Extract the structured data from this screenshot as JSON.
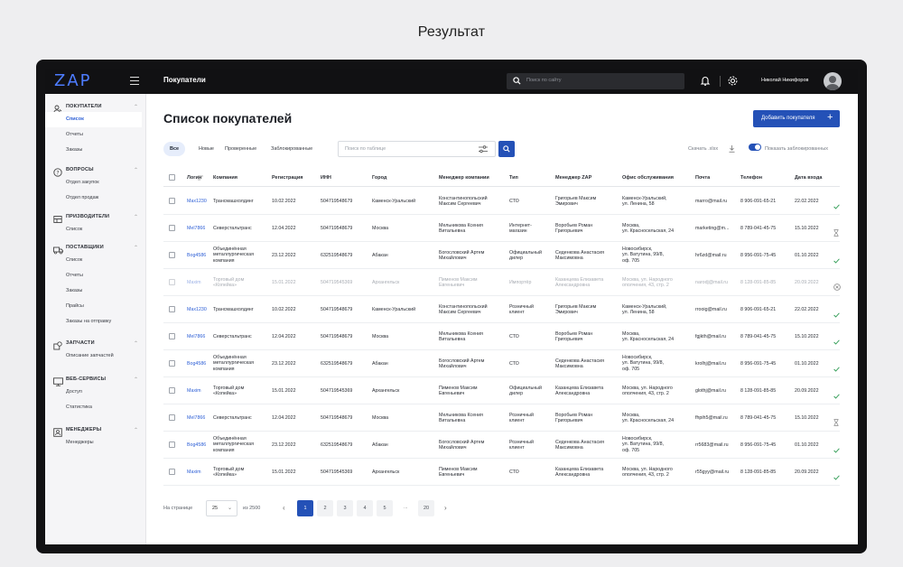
{
  "page_heading": "Результат",
  "topbar": {
    "logo": "ZAP",
    "title": "Покупатели",
    "search_placeholder": "Поиск по сайту",
    "user_name": "Николай Никифоров"
  },
  "sidebar": {
    "sections": [
      {
        "title": "ПОКУПАТЕЛИ",
        "icon": "users-icon",
        "items": [
          "Список",
          "Отчеты",
          "Заказы"
        ]
      },
      {
        "title": "ВОПРОСЫ",
        "icon": "question-icon",
        "items": [
          "Отдел закупок",
          "Отдел продаж"
        ]
      },
      {
        "title": "ПРИЗВОДИТЕЛИ",
        "icon": "factory-icon",
        "items": [
          "Список"
        ]
      },
      {
        "title": "ПОСТАВЩИКИ",
        "icon": "truck-icon",
        "items": [
          "Список",
          "Отчеты",
          "Заказы",
          "Прайсы",
          "Заказы на отправку"
        ]
      },
      {
        "title": "ЗАПЧАСТИ",
        "icon": "parts-icon",
        "items": [
          "Описание запчастей"
        ]
      },
      {
        "title": "ВЕБ-СЕРВИСЫ",
        "icon": "monitor-icon",
        "items": [
          "Доступ",
          "Статистика"
        ]
      },
      {
        "title": "МЕНЕДЖЕРЫ",
        "icon": "id-card-icon",
        "items": [
          "Менеджеры"
        ]
      }
    ]
  },
  "main": {
    "title": "Список покупателей",
    "add_button": "Добавить покупателя",
    "filters": [
      "Все",
      "Новые",
      "Проверенные",
      "Заблокированные"
    ],
    "table_search_placeholder": "Поиск по таблице",
    "download": "Скачать .xlsx",
    "toggle_label": "Показать заблокированных"
  },
  "table": {
    "columns": [
      "Логин",
      "Компания",
      "Регистрация",
      "ИНН",
      "Город",
      "Менеджер компании",
      "Тип",
      "Менеджер ZAP",
      "Офис обслуживания",
      "Почта",
      "Телефон",
      "Дата входа"
    ],
    "rows": [
      {
        "login": "Max1230",
        "company": [
          "Трансмашхолдинг"
        ],
        "reg": "10.02.2022",
        "inn": "504719548679",
        "city": "Каменск-Уральский",
        "manager": [
          "Константинопольский",
          "Максим Сергеевич"
        ],
        "type": [
          "СТО"
        ],
        "zap": [
          "Григорьев Максим",
          "Эмирович"
        ],
        "office": [
          "Каменск-Уральский,",
          "ул. Ленина, 58"
        ],
        "email": "marro@mail.ru",
        "phone": "8 906-091-65-21",
        "date": "22.02.2022",
        "status": "check",
        "dim": false
      },
      {
        "login": "Mel7866",
        "company": [
          "Северстальтранс"
        ],
        "reg": "12.04.2022",
        "inn": "504719548679",
        "city": "Москва",
        "manager": [
          "Мельникова Ксения",
          "Витальевна"
        ],
        "type": [
          "Интернет-",
          "магазин"
        ],
        "zap": [
          "Воробьев Роман",
          "Григорьевич"
        ],
        "office": [
          "Москва,",
          "ул. Красносельская, 24"
        ],
        "email": "marketing@m...",
        "phone": "8 789-041-45-75",
        "date": "15.10.2022",
        "status": "hourglass",
        "dim": false
      },
      {
        "login": "Bog4586",
        "company": [
          "Объединённая",
          "металлургическая",
          "компания"
        ],
        "reg": "23.12.2022",
        "inn": "632519548679",
        "city": "Абакан",
        "manager": [
          "Богословский Артем",
          "Михайлович"
        ],
        "type": [
          "Официальный",
          "дилер"
        ],
        "zap": [
          "Седенкова Анастасия",
          "Максимовна"
        ],
        "office": [
          "Новосибирск,",
          "ул. Ватутина, 99/8,",
          "оф. 705"
        ],
        "email": "hr6zd@mail.ru",
        "phone": "8 956-091-75-45",
        "date": "01.10.2022",
        "status": "check",
        "dim": false
      },
      {
        "login": "Maxim",
        "company": [
          "Торговый дом",
          "«Копейка»"
        ],
        "reg": "15.01.2022",
        "inn": "504719545369",
        "city": "Архангельск",
        "manager": [
          "Пименов Максим",
          "Евгеньевич"
        ],
        "type": [
          "Импортёр"
        ],
        "zap": [
          "Казанцева Елизавета",
          "Александровна"
        ],
        "office": [
          "Москва, ул. Народного",
          "ополчения, 43, стр. 2"
        ],
        "email": "narodj@mail.ru",
        "phone": "8 128-091-85-85",
        "date": "20.09.2022",
        "status": "blocked",
        "dim": true
      },
      {
        "login": "Max1230",
        "company": [
          "Трансмашхолдинг"
        ],
        "reg": "10.02.2022",
        "inn": "504719548679",
        "city": "Каменск-Уральский",
        "manager": [
          "Константинопольский",
          "Максим Сергеевич"
        ],
        "type": [
          "Розничный",
          "клиент"
        ],
        "zap": [
          "Григорьев Максим",
          "Эмирович"
        ],
        "office": [
          "Каменск-Уральский,",
          "ул. Ленина, 58"
        ],
        "email": "rrooig@mail.ru",
        "phone": "8 906-091-65-21",
        "date": "22.02.2022",
        "status": "check",
        "dim": false
      },
      {
        "login": "Mel7866",
        "company": [
          "Северстальтранс"
        ],
        "reg": "12.04.2022",
        "inn": "504719548679",
        "city": "Москва",
        "manager": [
          "Мельникова Ксения",
          "Витальевна"
        ],
        "type": [
          "СТО"
        ],
        "zap": [
          "Воробьев Роман",
          "Григорьевич"
        ],
        "office": [
          "Москва,",
          "ул. Красносельская, 24"
        ],
        "email": "fgjkth@mail.ru",
        "phone": "8 789-041-45-75",
        "date": "15.10.2022",
        "status": "check",
        "dim": false
      },
      {
        "login": "Bog4586",
        "company": [
          "Объединённая",
          "металлургическая",
          "компания"
        ],
        "reg": "23.12.2022",
        "inn": "632519548679",
        "city": "Абакан",
        "manager": [
          "Богословский Артем",
          "Михайлович"
        ],
        "type": [
          "СТО"
        ],
        "zap": [
          "Седенкова Анастасия",
          "Максимовна"
        ],
        "office": [
          "Новосибирск,",
          "ул. Ватутина, 99/8,",
          "оф. 705"
        ],
        "email": "krolhj@mail.ru",
        "phone": "8 956-091-75-45",
        "date": "01.10.2022",
        "status": "check",
        "dim": false
      },
      {
        "login": "Maxim",
        "company": [
          "Торговый дом",
          "«Копейка»"
        ],
        "reg": "15.01.2022",
        "inn": "504719545369",
        "city": "Архангельск",
        "manager": [
          "Пименов Максим",
          "Евгеньевич"
        ],
        "type": [
          "Официальный",
          "дилер"
        ],
        "zap": [
          "Казанцева Елизавета",
          "Александровна"
        ],
        "office": [
          "Москва, ул. Народного",
          "ополчения, 43, стр. 2"
        ],
        "email": "glothj@mail.ru",
        "phone": "8 128-091-85-85",
        "date": "20.09.2022",
        "status": "check",
        "dim": false
      },
      {
        "login": "Mel7866",
        "company": [
          "Северстальтранс"
        ],
        "reg": "12.04.2022",
        "inn": "504719548679",
        "city": "Москва",
        "manager": [
          "Мельникова Ксения",
          "Витальевна"
        ],
        "type": [
          "Розничный",
          "клиент"
        ],
        "zap": [
          "Воробьев Роман",
          "Григорьевич"
        ],
        "office": [
          "Москва,",
          "ул. Красносельская, 24"
        ],
        "email": "fhpih5@mail.ru",
        "phone": "8 789-041-45-75",
        "date": "15.10.2022",
        "status": "hourglass",
        "dim": false
      },
      {
        "login": "Bog4586",
        "company": [
          "Объединённая",
          "металлургическая",
          "компания"
        ],
        "reg": "23.12.2022",
        "inn": "632519548679",
        "city": "Абакан",
        "manager": [
          "Богословский Артем",
          "Михайлович"
        ],
        "type": [
          "Розничный",
          "клиент"
        ],
        "zap": [
          "Седенкова Анастасия",
          "Максимовна"
        ],
        "office": [
          "Новосибирск,",
          "ул. Ватутина, 99/8,",
          "оф. 705"
        ],
        "email": "rr5683@mail.ru",
        "phone": "8 956-091-75-45",
        "date": "01.10.2022",
        "status": "check",
        "dim": false
      },
      {
        "login": "Maxim",
        "company": [
          "Торговый дом",
          "«Копейка»"
        ],
        "reg": "15.01.2022",
        "inn": "504719545369",
        "city": "Архангельск",
        "manager": [
          "Пименов Максим",
          "Евгеньевич"
        ],
        "type": [
          "СТО"
        ],
        "zap": [
          "Казанцева Елизавета",
          "Александровна"
        ],
        "office": [
          "Москва, ул. Народного",
          "ополчения, 43, стр. 2"
        ],
        "email": "r55gyy@mail.ru",
        "phone": "8 128-091-85-85",
        "date": "20.09.2022",
        "status": "check",
        "dim": false
      }
    ]
  },
  "pagination": {
    "per_page_label": "На странице",
    "per_page_value": "25",
    "total_label": "из 2500",
    "pages": [
      "1",
      "2",
      "3",
      "4",
      "5"
    ],
    "ellipsis": "...",
    "last_page": "20",
    "current": "1"
  },
  "colors": {
    "accent": "#2451b7",
    "ok": "#2c9a52",
    "muted": "#9aa0a8"
  }
}
